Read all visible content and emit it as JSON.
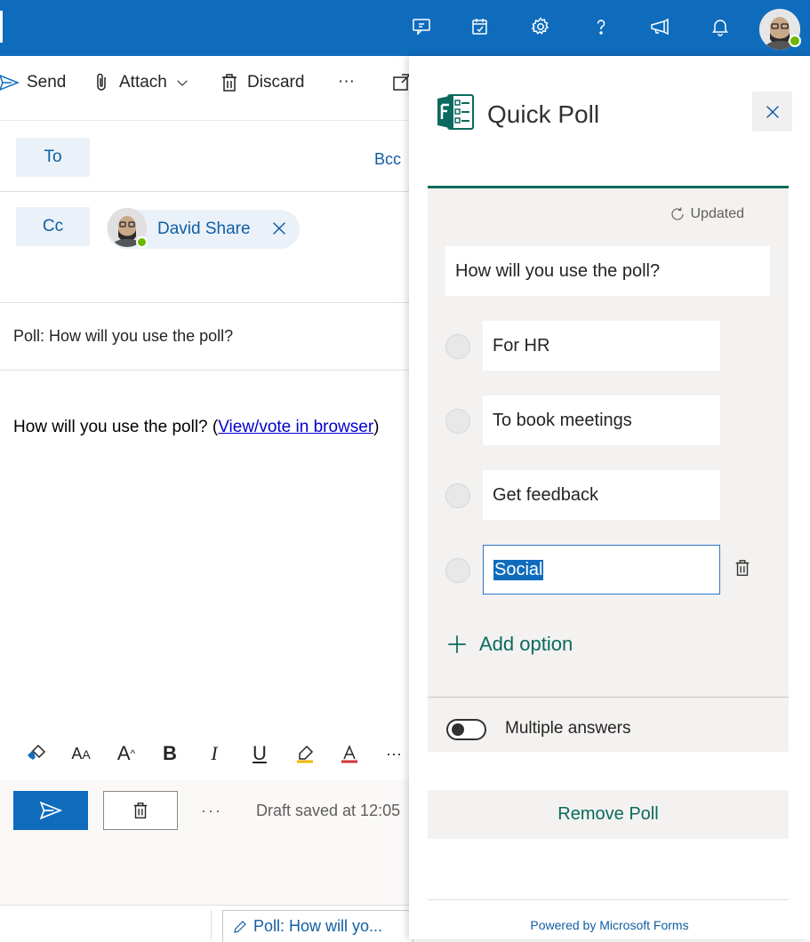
{
  "colors": {
    "brand_blue": "#0f6cbd",
    "forms_green": "#0b6a5e",
    "link_blue": "#115ea3",
    "presence_green": "#6bb700"
  },
  "header": {
    "icons": [
      "meeting-icon",
      "todo-icon",
      "gear-icon",
      "help-icon",
      "feedback-icon",
      "bell-icon"
    ],
    "avatar": "user-avatar"
  },
  "toolbar": {
    "send_label": "Send",
    "attach_label": "Attach",
    "discard_label": "Discard",
    "more_label": "···"
  },
  "recipients": {
    "to_label": "To",
    "bcc_label": "Bcc",
    "cc_label": "Cc",
    "cc_chip_name": "David Share"
  },
  "message": {
    "subject": "Poll: How will you use the poll?",
    "body_text": "How will you use the poll? (",
    "link_text": "View/vote in browser",
    "body_close": ")"
  },
  "format_bar": {
    "items": [
      "format-painter-icon",
      "font-size-icon",
      "grow-font-icon",
      "bold-icon",
      "italic-icon",
      "underline-icon",
      "highlight-icon",
      "font-color-icon",
      "more-icon"
    ],
    "more_label": "···"
  },
  "footer": {
    "more_label": "···",
    "draft_status": "Draft saved at 12:05",
    "draft_tab_label": "Poll: How will yo..."
  },
  "quick_poll": {
    "title": "Quick Poll",
    "updated_label": "Updated",
    "question": "How will you use the poll?",
    "options": [
      "For HR",
      "To book meetings",
      "Get feedback",
      "Social"
    ],
    "add_option_label": "Add option",
    "multiple_answers_label": "Multiple answers",
    "multiple_answers_enabled": false,
    "remove_label": "Remove Poll",
    "powered_by": "Powered by Microsoft Forms"
  }
}
